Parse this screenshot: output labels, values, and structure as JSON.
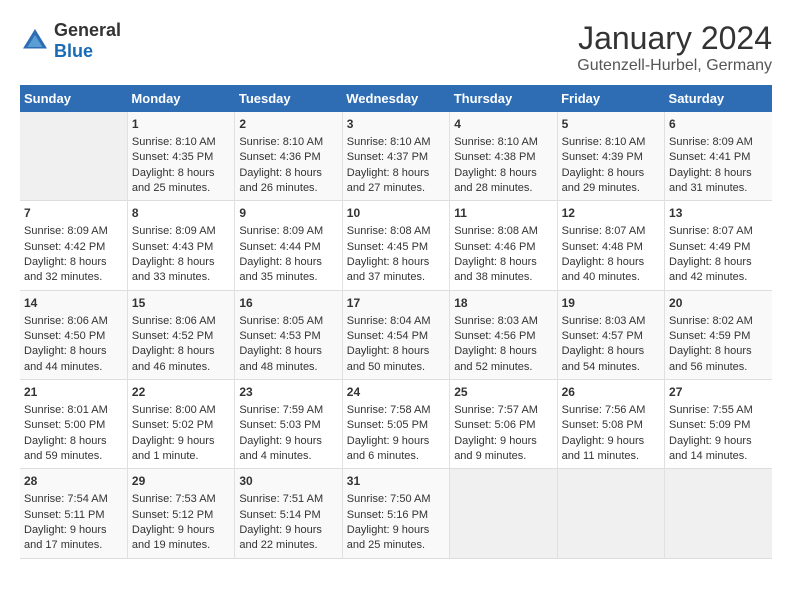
{
  "header": {
    "logo_general": "General",
    "logo_blue": "Blue",
    "main_title": "January 2024",
    "subtitle": "Gutenzell-Hurbel, Germany"
  },
  "weekdays": [
    "Sunday",
    "Monday",
    "Tuesday",
    "Wednesday",
    "Thursday",
    "Friday",
    "Saturday"
  ],
  "weeks": [
    {
      "cells": [
        {
          "day": "",
          "empty": true
        },
        {
          "day": "1",
          "sunrise": "Sunrise: 8:10 AM",
          "sunset": "Sunset: 4:35 PM",
          "daylight": "Daylight: 8 hours and 25 minutes."
        },
        {
          "day": "2",
          "sunrise": "Sunrise: 8:10 AM",
          "sunset": "Sunset: 4:36 PM",
          "daylight": "Daylight: 8 hours and 26 minutes."
        },
        {
          "day": "3",
          "sunrise": "Sunrise: 8:10 AM",
          "sunset": "Sunset: 4:37 PM",
          "daylight": "Daylight: 8 hours and 27 minutes."
        },
        {
          "day": "4",
          "sunrise": "Sunrise: 8:10 AM",
          "sunset": "Sunset: 4:38 PM",
          "daylight": "Daylight: 8 hours and 28 minutes."
        },
        {
          "day": "5",
          "sunrise": "Sunrise: 8:10 AM",
          "sunset": "Sunset: 4:39 PM",
          "daylight": "Daylight: 8 hours and 29 minutes."
        },
        {
          "day": "6",
          "sunrise": "Sunrise: 8:09 AM",
          "sunset": "Sunset: 4:41 PM",
          "daylight": "Daylight: 8 hours and 31 minutes."
        }
      ]
    },
    {
      "cells": [
        {
          "day": "7",
          "sunrise": "Sunrise: 8:09 AM",
          "sunset": "Sunset: 4:42 PM",
          "daylight": "Daylight: 8 hours and 32 minutes."
        },
        {
          "day": "8",
          "sunrise": "Sunrise: 8:09 AM",
          "sunset": "Sunset: 4:43 PM",
          "daylight": "Daylight: 8 hours and 33 minutes."
        },
        {
          "day": "9",
          "sunrise": "Sunrise: 8:09 AM",
          "sunset": "Sunset: 4:44 PM",
          "daylight": "Daylight: 8 hours and 35 minutes."
        },
        {
          "day": "10",
          "sunrise": "Sunrise: 8:08 AM",
          "sunset": "Sunset: 4:45 PM",
          "daylight": "Daylight: 8 hours and 37 minutes."
        },
        {
          "day": "11",
          "sunrise": "Sunrise: 8:08 AM",
          "sunset": "Sunset: 4:46 PM",
          "daylight": "Daylight: 8 hours and 38 minutes."
        },
        {
          "day": "12",
          "sunrise": "Sunrise: 8:07 AM",
          "sunset": "Sunset: 4:48 PM",
          "daylight": "Daylight: 8 hours and 40 minutes."
        },
        {
          "day": "13",
          "sunrise": "Sunrise: 8:07 AM",
          "sunset": "Sunset: 4:49 PM",
          "daylight": "Daylight: 8 hours and 42 minutes."
        }
      ]
    },
    {
      "cells": [
        {
          "day": "14",
          "sunrise": "Sunrise: 8:06 AM",
          "sunset": "Sunset: 4:50 PM",
          "daylight": "Daylight: 8 hours and 44 minutes."
        },
        {
          "day": "15",
          "sunrise": "Sunrise: 8:06 AM",
          "sunset": "Sunset: 4:52 PM",
          "daylight": "Daylight: 8 hours and 46 minutes."
        },
        {
          "day": "16",
          "sunrise": "Sunrise: 8:05 AM",
          "sunset": "Sunset: 4:53 PM",
          "daylight": "Daylight: 8 hours and 48 minutes."
        },
        {
          "day": "17",
          "sunrise": "Sunrise: 8:04 AM",
          "sunset": "Sunset: 4:54 PM",
          "daylight": "Daylight: 8 hours and 50 minutes."
        },
        {
          "day": "18",
          "sunrise": "Sunrise: 8:03 AM",
          "sunset": "Sunset: 4:56 PM",
          "daylight": "Daylight: 8 hours and 52 minutes."
        },
        {
          "day": "19",
          "sunrise": "Sunrise: 8:03 AM",
          "sunset": "Sunset: 4:57 PM",
          "daylight": "Daylight: 8 hours and 54 minutes."
        },
        {
          "day": "20",
          "sunrise": "Sunrise: 8:02 AM",
          "sunset": "Sunset: 4:59 PM",
          "daylight": "Daylight: 8 hours and 56 minutes."
        }
      ]
    },
    {
      "cells": [
        {
          "day": "21",
          "sunrise": "Sunrise: 8:01 AM",
          "sunset": "Sunset: 5:00 PM",
          "daylight": "Daylight: 8 hours and 59 minutes."
        },
        {
          "day": "22",
          "sunrise": "Sunrise: 8:00 AM",
          "sunset": "Sunset: 5:02 PM",
          "daylight": "Daylight: 9 hours and 1 minute."
        },
        {
          "day": "23",
          "sunrise": "Sunrise: 7:59 AM",
          "sunset": "Sunset: 5:03 PM",
          "daylight": "Daylight: 9 hours and 4 minutes."
        },
        {
          "day": "24",
          "sunrise": "Sunrise: 7:58 AM",
          "sunset": "Sunset: 5:05 PM",
          "daylight": "Daylight: 9 hours and 6 minutes."
        },
        {
          "day": "25",
          "sunrise": "Sunrise: 7:57 AM",
          "sunset": "Sunset: 5:06 PM",
          "daylight": "Daylight: 9 hours and 9 minutes."
        },
        {
          "day": "26",
          "sunrise": "Sunrise: 7:56 AM",
          "sunset": "Sunset: 5:08 PM",
          "daylight": "Daylight: 9 hours and 11 minutes."
        },
        {
          "day": "27",
          "sunrise": "Sunrise: 7:55 AM",
          "sunset": "Sunset: 5:09 PM",
          "daylight": "Daylight: 9 hours and 14 minutes."
        }
      ]
    },
    {
      "cells": [
        {
          "day": "28",
          "sunrise": "Sunrise: 7:54 AM",
          "sunset": "Sunset: 5:11 PM",
          "daylight": "Daylight: 9 hours and 17 minutes."
        },
        {
          "day": "29",
          "sunrise": "Sunrise: 7:53 AM",
          "sunset": "Sunset: 5:12 PM",
          "daylight": "Daylight: 9 hours and 19 minutes."
        },
        {
          "day": "30",
          "sunrise": "Sunrise: 7:51 AM",
          "sunset": "Sunset: 5:14 PM",
          "daylight": "Daylight: 9 hours and 22 minutes."
        },
        {
          "day": "31",
          "sunrise": "Sunrise: 7:50 AM",
          "sunset": "Sunset: 5:16 PM",
          "daylight": "Daylight: 9 hours and 25 minutes."
        },
        {
          "day": "",
          "empty": true
        },
        {
          "day": "",
          "empty": true
        },
        {
          "day": "",
          "empty": true
        }
      ]
    }
  ]
}
